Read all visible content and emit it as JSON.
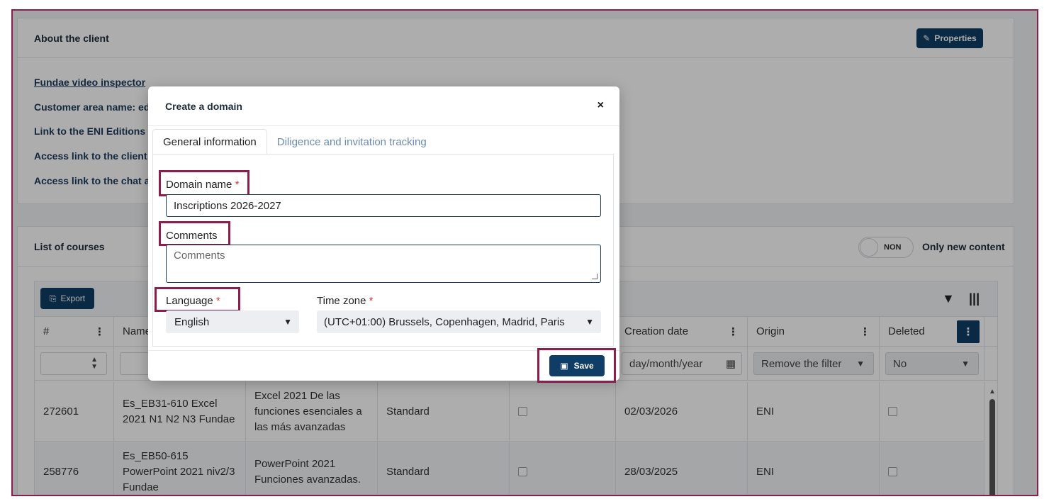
{
  "client_panel": {
    "title": "About the client",
    "properties_label": "Properties",
    "lines": [
      "Fundae video inspector",
      "Customer area name: edi",
      "Link to the ENI Editions h",
      "Access link to the client F",
      "Access link to the chat ac"
    ]
  },
  "courses_panel": {
    "title": "List of courses",
    "toggle_text": "NON",
    "only_new_label": "Only new content",
    "export_label": "Export",
    "columns": [
      "#",
      "Name",
      "",
      "",
      "",
      "Creation date",
      "Origin",
      "Deleted"
    ],
    "filters": {
      "date_placeholder": "day/month/year",
      "origin_value": "Remove the filter",
      "deleted_value": "No"
    },
    "rows": [
      {
        "id": "272601",
        "name": "Es_EB31-610 Excel 2021 N1 N2 N3 Fundae",
        "title": "Excel 2021 De las funciones esenciales a las más avanzadas",
        "type": "Standard",
        "date": "02/03/2026",
        "origin": "ENI"
      },
      {
        "id": "258776",
        "name": "Es_EB50-615 PowerPoint 2021 niv2/3 Fundae",
        "title": "PowerPoint 2021 Funciones avanzadas.",
        "type": "Standard",
        "date": "28/03/2025",
        "origin": "ENI"
      }
    ]
  },
  "modal": {
    "title": "Create a domain",
    "close_glyph": "×",
    "tabs": [
      "General information",
      "Diligence and invitation tracking"
    ],
    "domain_name_label": "Domain name",
    "domain_name_value": "Inscriptions 2026-2027",
    "comments_label": "Comments",
    "comments_placeholder": "Comments",
    "language_label": "Language",
    "language_value": "English",
    "timezone_label": "Time zone",
    "timezone_value": "(UTC+01:00) Brussels, Copenhagen, Madrid, Paris",
    "required_mark": "*",
    "save_label": "Save"
  },
  "colors": {
    "primary": "#0f3d66",
    "highlight": "#8a1e4c",
    "required": "#d93b3b"
  }
}
